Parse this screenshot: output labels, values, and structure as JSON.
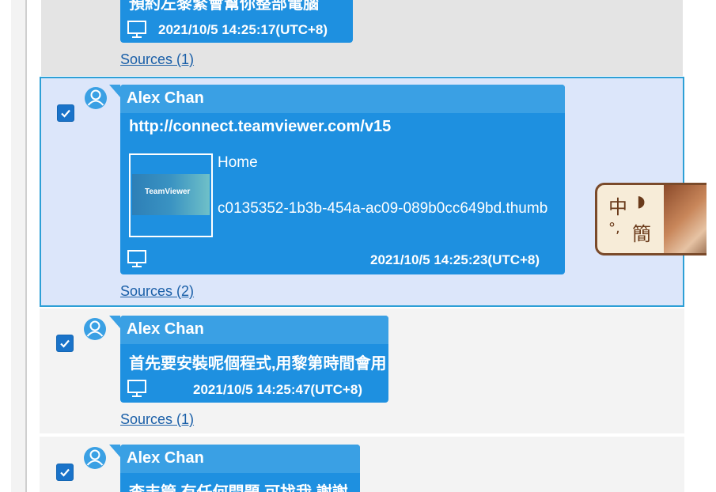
{
  "messages": [
    {
      "body": "預約左黎緊會幫你整部電腦",
      "timestamp": "2021/10/5 14:25:17(UTC+8)",
      "sources": "Sources (1)"
    },
    {
      "sender": "Alex Chan",
      "body": "http://connect.teamviewer.com/v15",
      "link_title": "Home",
      "link_file": "c0135352-1b3b-454a-ac09-089b0cc649bd.thumb",
      "thumb_logo": "TeamViewer",
      "timestamp": "2021/10/5 14:25:23(UTC+8)",
      "sources": "Sources (2)",
      "checked": true,
      "selected": true
    },
    {
      "sender": "Alex Chan",
      "body": "首先要安裝呢個程式,用黎第時間會用",
      "timestamp": "2021/10/5 14:25:47(UTC+8)",
      "sources": "Sources (1)",
      "checked": true
    },
    {
      "sender": "Alex Chan",
      "body": "李丰管 有任何問題 可找我 謝謝",
      "checked": true
    }
  ],
  "ime": {
    "mode_char": "中",
    "moon_char": "◗",
    "punct_char": "°,",
    "script_char": "簡"
  },
  "colors": {
    "bubble": "#1e90e0",
    "bubble_header": "#3aa0e4",
    "selected_bg": "#dce6fa",
    "selected_border": "#2d9fd6",
    "grey_row": "#e4e4e4",
    "link": "#1a5fa8"
  }
}
